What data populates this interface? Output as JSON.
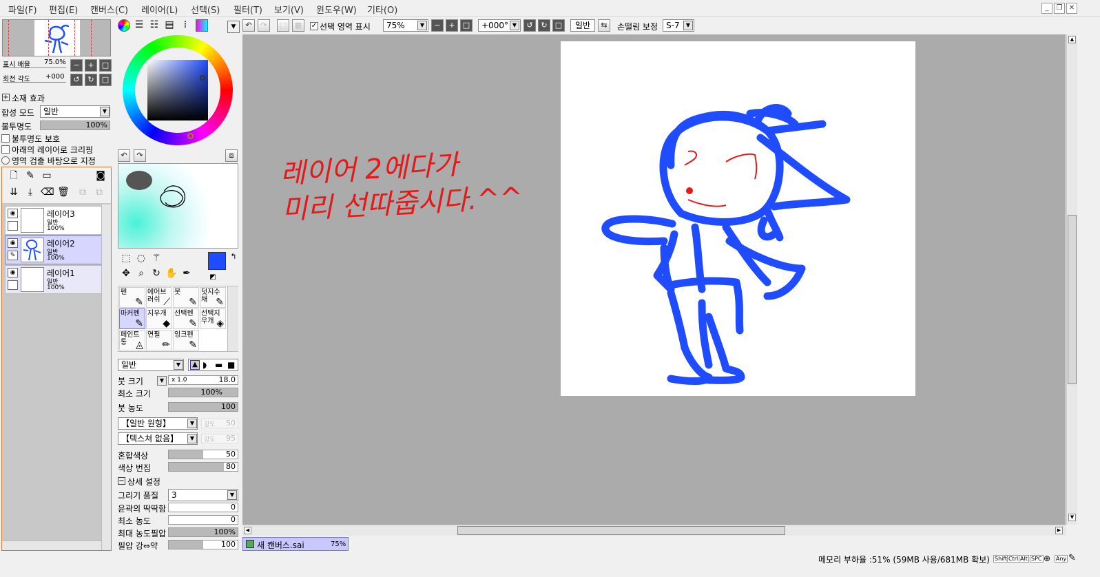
{
  "menu": [
    "파일(F)",
    "편집(E)",
    "캔버스(C)",
    "레이어(L)",
    "선택(S)",
    "필터(T)",
    "보기(V)",
    "윈도우(W)",
    "기타(O)"
  ],
  "window_buttons": {
    "minimize": "_",
    "restore": "❐",
    "close": "✕"
  },
  "navigator": {
    "zoom_label": "표시 배율",
    "zoom_value": "75.0%",
    "rotate_label": "회전 각도",
    "rotate_value": "+000"
  },
  "layer_props": {
    "section_title": "소재 효과",
    "blend_label": "합성 모드",
    "blend_value": "일반",
    "opacity_label": "불투명도",
    "opacity_value": "100%",
    "opacity_level": 1.0,
    "protect_opacity": "불투명도 보호",
    "clip_lower": "아래의 레이어로 크리핑",
    "selection_source": "영역 검출 바탕으로 지정"
  },
  "layers": [
    {
      "name": "레이어3",
      "mode": "일반",
      "opacity": "100%"
    },
    {
      "name": "레이어2",
      "mode": "일반",
      "opacity": "100%"
    },
    {
      "name": "레이어1",
      "mode": "일반",
      "opacity": "100%"
    }
  ],
  "toolbar": {
    "show_selection_label": "선택 영역 표시",
    "zoom": "75%",
    "rotation": "+000°",
    "blend": "일반",
    "stabilizer_label": "손떨림 보정",
    "stabilizer_value": "S-7"
  },
  "tools": [
    {
      "label": "펜",
      "icon": "pen-icon"
    },
    {
      "label": "에어브러쉬",
      "icon": "airbrush-icon"
    },
    {
      "label": "붓",
      "icon": "brush-icon"
    },
    {
      "label": "덧지수채",
      "icon": "watercolor-icon"
    },
    {
      "label": "마커펜",
      "icon": "marker-icon"
    },
    {
      "label": "지우개",
      "icon": "eraser-icon"
    },
    {
      "label": "선택펜",
      "icon": "select-pen-icon"
    },
    {
      "label": "선택지우개",
      "icon": "select-eraser-icon"
    },
    {
      "label": "페인트통",
      "icon": "bucket-icon"
    },
    {
      "label": "연필",
      "icon": "pencil-icon"
    },
    {
      "label": "잉크펜",
      "icon": "ink-pen-icon"
    }
  ],
  "brush": {
    "shape_value": "일반",
    "size_label": "붓 크기",
    "size_mult": "x 1.0",
    "size_value": "18.0",
    "min_size_label": "최소 크기",
    "min_size_value": "100%",
    "min_size_level": 1.0,
    "density_label": "붓 농도",
    "density_value": "100",
    "density_level": 1.0,
    "shape1": "【일반 원형】",
    "shape1_strength": "강도",
    "shape1_value": "50",
    "shape2": "【텍스쳐 없음】",
    "shape2_strength": "강도",
    "shape2_value": "95",
    "blend_label": "혼합색상",
    "blend_value": "50",
    "blend_level": 0.5,
    "dilute_label": "색상 번짐",
    "dilute_value": "80",
    "dilute_level": 0.8,
    "advanced_label": "상세 설정",
    "quality_label": "그리기 품질",
    "quality_value": "3",
    "edge_label": "윤곽의 딱딱함",
    "edge_value": "0",
    "edge_level": 0,
    "min_density_label": "최소 농도",
    "min_density_value": "0",
    "min_density_level": 0,
    "max_pressure_label": "최대 농도필압",
    "max_pressure_value": "100%",
    "max_pressure_level": 1.0,
    "pressure_label": "필압 강⇔약",
    "pressure_value": "100",
    "pressure_level": 0.5
  },
  "canvas_text": [
    "레이어 2에다가",
    "미리 선따줍시다.^^"
  ],
  "document_tab": {
    "name": "새 캔버스.sai",
    "zoom": "75%"
  },
  "status": {
    "memory": "메모리 부하율 :51% (59MB 사용/681MB 확보)",
    "keys": [
      "Shift",
      "Ctrl",
      "Alt",
      "SPC",
      "Any"
    ]
  },
  "colors": {
    "accent": "#1f4cff",
    "ink_red": "#e41a1a",
    "canvas_bg": "#ababab",
    "selected_layer": "#d6d6ff"
  }
}
